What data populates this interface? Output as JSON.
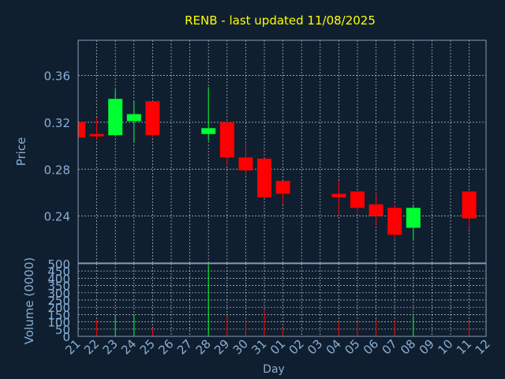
{
  "chart_data": {
    "type": "candlestick",
    "title": "RENB - last updated 11/08/2025",
    "xlabel": "Day",
    "price_panel": {
      "ylabel": "Price",
      "ylim": [
        0.2,
        0.39
      ],
      "yticks": [
        "0.24",
        "0.28",
        "0.32",
        "0.36"
      ],
      "grid": true
    },
    "volume_panel": {
      "ylabel": "Volume (0000)",
      "ylim": [
        0,
        500
      ],
      "yticks": [
        "0",
        "50",
        "100",
        "150",
        "200",
        "250",
        "300",
        "350",
        "400",
        "450",
        "500"
      ],
      "grid": true
    },
    "x_ticks": [
      "21",
      "22",
      "23",
      "24",
      "25",
      "26",
      "27",
      "28",
      "29",
      "30",
      "31",
      "01",
      "02",
      "03",
      "04",
      "05",
      "06",
      "07",
      "08",
      "09",
      "10",
      "11",
      "12"
    ],
    "candles": [
      {
        "day": "21",
        "open": 0.32,
        "high": 0.32,
        "low": 0.307,
        "close": 0.307,
        "volume": 0
      },
      {
        "day": "22",
        "open": 0.31,
        "high": 0.324,
        "low": 0.305,
        "close": 0.308,
        "volume": 115
      },
      {
        "day": "23",
        "open": 0.309,
        "high": 0.348,
        "low": 0.309,
        "close": 0.34,
        "volume": 145
      },
      {
        "day": "24",
        "open": 0.321,
        "high": 0.338,
        "low": 0.303,
        "close": 0.327,
        "volume": 145
      },
      {
        "day": "25",
        "open": 0.338,
        "high": 0.338,
        "low": 0.308,
        "close": 0.309,
        "volume": 55
      },
      {
        "day": "28",
        "open": 0.31,
        "high": 0.35,
        "low": 0.304,
        "close": 0.315,
        "volume": 500
      },
      {
        "day": "29",
        "open": 0.32,
        "high": 0.32,
        "low": 0.283,
        "close": 0.29,
        "volume": 145
      },
      {
        "day": "30",
        "open": 0.29,
        "high": 0.303,
        "low": 0.275,
        "close": 0.279,
        "volume": 105
      },
      {
        "day": "31",
        "open": 0.289,
        "high": 0.289,
        "low": 0.255,
        "close": 0.256,
        "volume": 185
      },
      {
        "day": "01",
        "open": 0.27,
        "high": 0.27,
        "low": 0.25,
        "close": 0.259,
        "volume": 55
      },
      {
        "day": "04",
        "open": 0.259,
        "high": 0.27,
        "low": 0.241,
        "close": 0.256,
        "volume": 105
      },
      {
        "day": "05",
        "open": 0.261,
        "high": 0.261,
        "low": 0.243,
        "close": 0.247,
        "volume": 100
      },
      {
        "day": "06",
        "open": 0.25,
        "high": 0.26,
        "low": 0.232,
        "close": 0.24,
        "volume": 120
      },
      {
        "day": "07",
        "open": 0.247,
        "high": 0.25,
        "low": 0.221,
        "close": 0.224,
        "volume": 110
      },
      {
        "day": "08",
        "open": 0.23,
        "high": 0.25,
        "low": 0.219,
        "close": 0.247,
        "volume": 140
      },
      {
        "day": "11",
        "open": 0.261,
        "high": 0.261,
        "low": 0.228,
        "close": 0.238,
        "volume": 100
      }
    ],
    "colors": {
      "up": "#00ff33",
      "down": "#ff0000",
      "background": "#0f1f2f",
      "frame": "#8a9bb3",
      "grid": "#ffffff",
      "tick_text": "#8aaed6",
      "title": "#ffff00"
    }
  }
}
